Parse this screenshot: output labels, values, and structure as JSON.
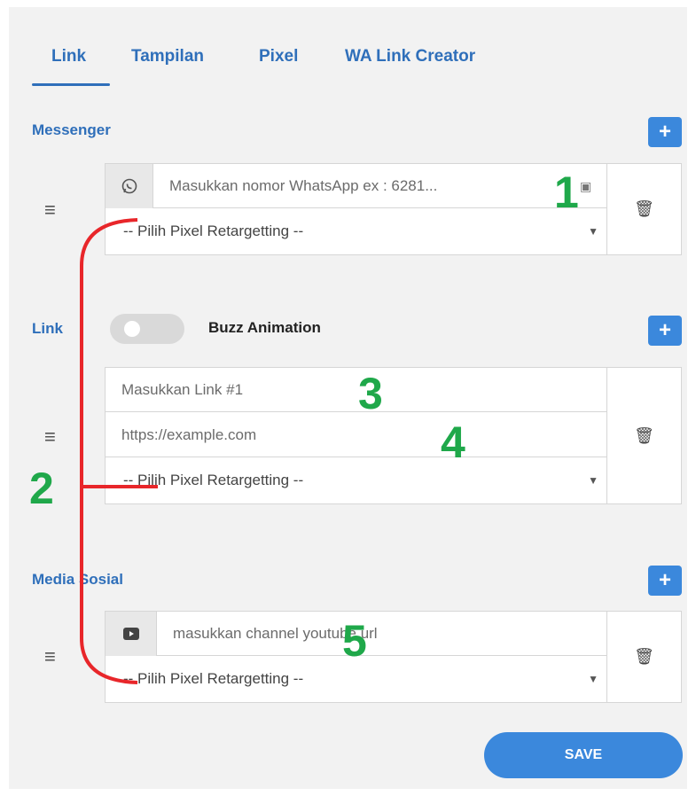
{
  "tabs": [
    {
      "label": "Link",
      "active": true
    },
    {
      "label": "Tampilan"
    },
    {
      "label": "Pixel"
    },
    {
      "label": "WA Link Creator"
    }
  ],
  "messenger": {
    "title": "Messenger",
    "add_label": "+",
    "whatsapp_placeholder": "Masukkan nomor WhatsApp ex : 6281...",
    "pixel_select": "-- Pilih Pixel Retargetting --"
  },
  "link": {
    "title": "Link",
    "add_label": "+",
    "buzz_label": "Buzz Animation",
    "buzz_enabled": false,
    "title_placeholder": "Masukkan Link #1",
    "url_placeholder": "https://example.com",
    "pixel_select": "-- Pilih Pixel Retargetting --"
  },
  "media_sosial": {
    "title": "Media Sosial",
    "add_label": "+",
    "youtube_placeholder": "masukkan channel youtube url",
    "pixel_select": "-- Pilih Pixel Retargetting --"
  },
  "save_label": "SAVE",
  "annotations": [
    "1",
    "2",
    "3",
    "4",
    "5"
  ],
  "colors": {
    "accent": "#3b88dc",
    "tab": "#2f6fba",
    "annotation": "#1fa84a",
    "bracket": "#e8262a"
  }
}
